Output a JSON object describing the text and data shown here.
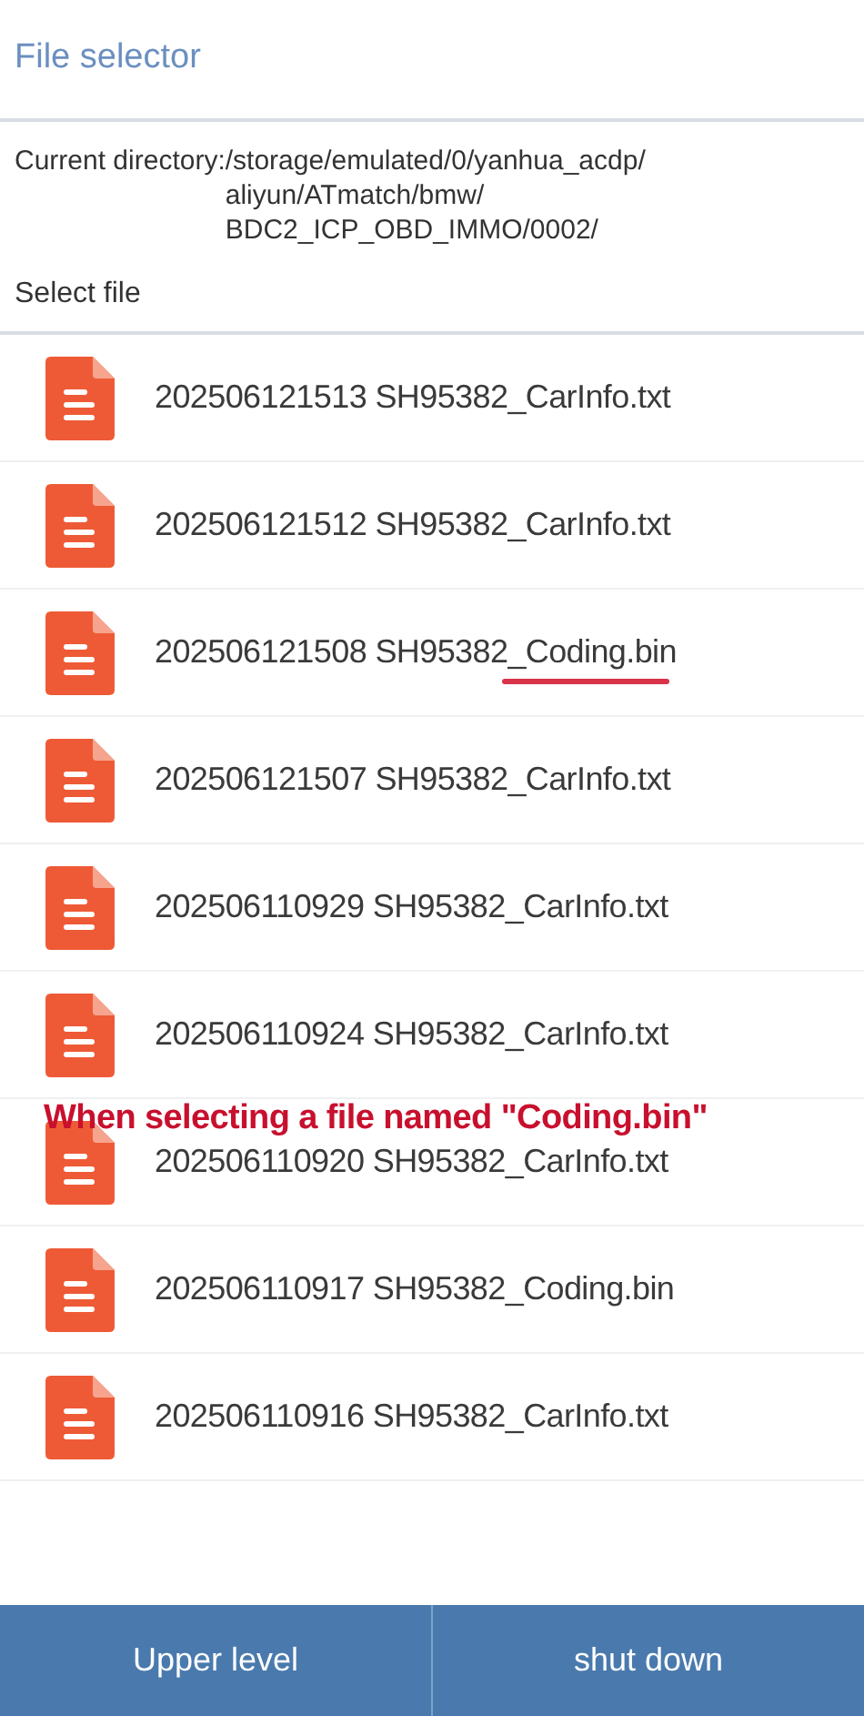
{
  "title": "File selector",
  "directory": {
    "label": "Current directory:",
    "path_lines": [
      "/storage/emulated/0/yanhua_acdp/",
      "aliyun/ATmatch/bmw/",
      "BDC2_ICP_OBD_IMMO/0002/"
    ]
  },
  "section_label": "Select file",
  "files": [
    {
      "name": "202506121513 SH95382_CarInfo.txt",
      "underlined": false
    },
    {
      "name": "202506121512 SH95382_CarInfo.txt",
      "underlined": false
    },
    {
      "name": "202506121508 SH95382_Coding.bin",
      "underlined": true
    },
    {
      "name": "202506121507 SH95382_CarInfo.txt",
      "underlined": false
    },
    {
      "name": "202506110929 SH95382_CarInfo.txt",
      "underlined": false
    },
    {
      "name": "202506110924 SH95382_CarInfo.txt",
      "underlined": false
    },
    {
      "name": "202506110920 SH95382_CarInfo.txt",
      "underlined": false
    },
    {
      "name": "202506110917 SH95382_Coding.bin",
      "underlined": false
    },
    {
      "name": "202506110916 SH95382_CarInfo.txt",
      "underlined": false
    }
  ],
  "annotation": "When selecting a file named \"Coding.bin\"",
  "buttons": [
    "Upper level",
    "shut down"
  ]
}
